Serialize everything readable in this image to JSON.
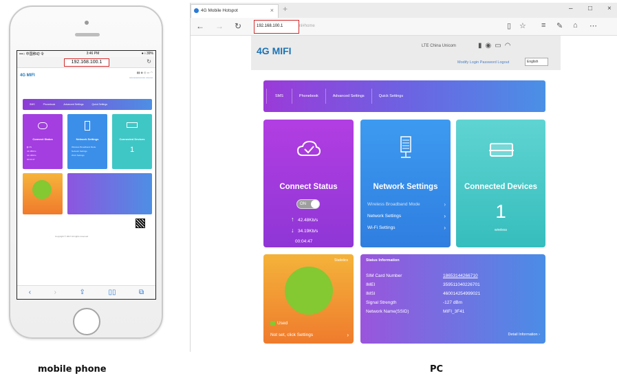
{
  "captions": {
    "mobile": "mobile phone",
    "pc": "PC"
  },
  "phone": {
    "status_left": "•••○ 中国移动 令",
    "time": "3:46 PM",
    "status_right": "● ⅰ 39%",
    "url": "192.168.100.1",
    "logo": "4G MIFI",
    "tiles": {
      "connect": "Connect Status",
      "network": "Network Settings",
      "devices": "Connected Devices",
      "devices_count": "1"
    },
    "footer": "Copyright © 2017 All rights reserved"
  },
  "browser": {
    "tab_title": "4G Mobile Hotspot",
    "url_host": "192.168.100.1",
    "url_path": "/index.html#home"
  },
  "page": {
    "logo": "4G MIFI",
    "carrier": "LTE  China Unicom",
    "links": "Modify Login Password  Logout",
    "language": "English",
    "menu": [
      "SMS",
      "Phonebook",
      "Advanced Settings",
      "Quick Settings"
    ],
    "connect": {
      "title": "Connect Status",
      "toggle": "ON",
      "up": "42.48Kb/s",
      "down": "34.19Kb/s",
      "duration": "00:04:47"
    },
    "network": {
      "title": "Network Settings",
      "items": [
        "Wireless Broadband Mode",
        "Network Settings",
        "Wi-Fi Settings"
      ]
    },
    "devices": {
      "title": "Connected Devices",
      "count": "1",
      "label": "wireless"
    },
    "statistics": {
      "label": "Statistics",
      "used": "Used",
      "not_set": "Not set, click Settings"
    },
    "status_info": {
      "title": "Status Information",
      "rows": [
        {
          "k": "SIM Card Number",
          "v": "18653144266710"
        },
        {
          "k": "IMEI",
          "v": "359511040226701"
        },
        {
          "k": "IMSI",
          "v": "460014254999021"
        },
        {
          "k": "Signal Strength",
          "v": "-127 dBm"
        },
        {
          "k": "Network Name(SSID)",
          "v": "MIFI_3F41"
        }
      ],
      "detail": "Detail Information"
    }
  }
}
